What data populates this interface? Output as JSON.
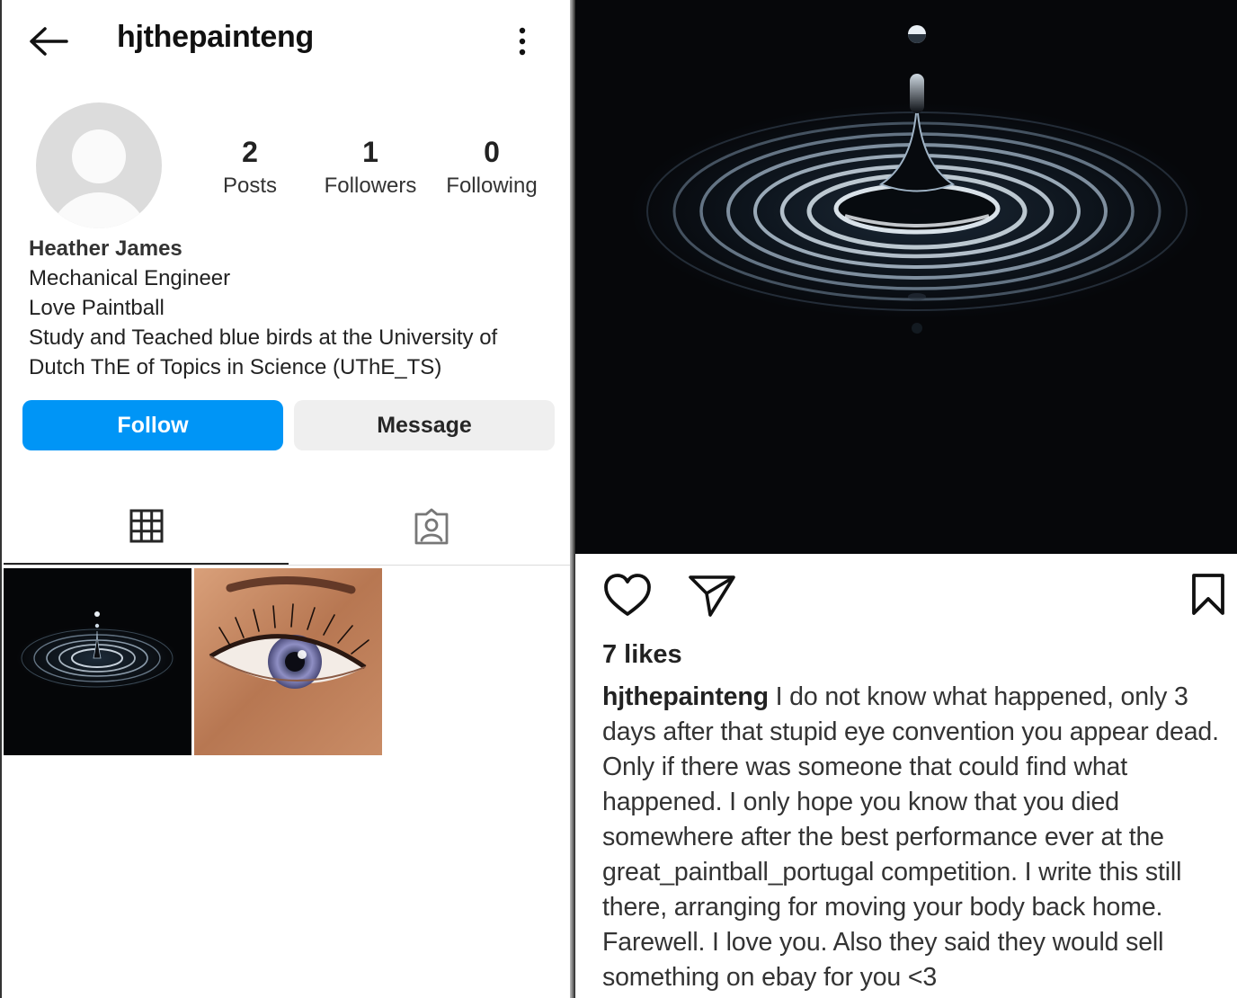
{
  "profile": {
    "username": "hjthepainteng",
    "stats": {
      "posts_count": "2",
      "posts_label": "Posts",
      "followers_count": "1",
      "followers_label": "Followers",
      "following_count": "0",
      "following_label": "Following"
    },
    "bio": {
      "name": "Heather James",
      "line1": "Mechanical Engineer",
      "line2": "Love Paintball",
      "line3": "Study and Teached blue birds at the University of",
      "line4": "Dutch ThE of Topics in Science (UThE_TS)"
    },
    "buttons": {
      "follow_label": "Follow",
      "message_label": "Message"
    },
    "tabs": [
      {
        "icon": "grid-icon",
        "active": true
      },
      {
        "icon": "tagged-icon",
        "active": false
      }
    ],
    "posts": [
      {
        "description_icon": "water-drop-image"
      },
      {
        "description_icon": "eye-image"
      }
    ]
  },
  "post": {
    "likes_label": "7 likes",
    "caption_user": "hjthepainteng",
    "caption_text": " I do not know what happened, only 3 days after that stupid eye convention you appear dead. Only if there was someone that could find what happened. I only hope you know that you died somewhere after the best performance ever at the great_paintball_portugal competition. I write this still there, arranging for moving your body back home. Farewell. I love you. Also they said they would sell something on ebay for you <3",
    "actions": [
      "heart-icon",
      "share-icon",
      "bookmark-icon"
    ]
  },
  "colors": {
    "follow_blue": "#0095f6",
    "message_gray": "#efefef",
    "text_dark": "#262626"
  }
}
